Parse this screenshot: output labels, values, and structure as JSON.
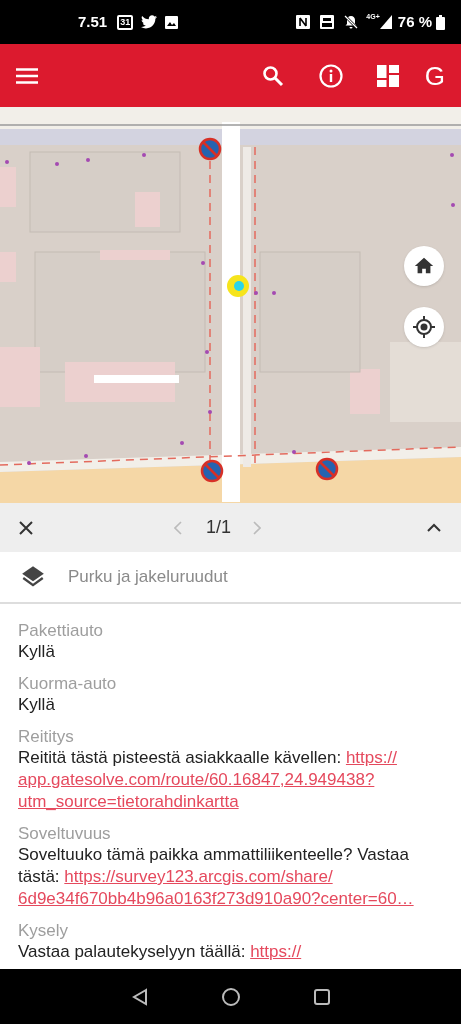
{
  "status_bar": {
    "time": "7.51",
    "calendar_day": "31",
    "network": "4G+",
    "battery": "76 %"
  },
  "app_bar": {
    "profile_letter": "G"
  },
  "popup": {
    "pager": "1/1",
    "layer": {
      "title": "Purku ja jakeluruudut"
    },
    "fields": [
      {
        "label": "Pakettiauto",
        "text": "Kyllä"
      },
      {
        "label": "Kuorma-auto",
        "text": "Kyllä"
      },
      {
        "label": "Reititys",
        "text": "Reititä tästä pisteestä asiakkaalle kävellen: ",
        "link_lines": [
          "https://",
          "app.gatesolve.com/route/60.16847,24.949438?",
          "utm_source=tietorahdinkartta"
        ]
      },
      {
        "label": "Soveltuvuus",
        "text": "Soveltuuko tämä paikka ammattiliikenteelle? Vastaa tästä: ",
        "link_lines": [
          "https://survey123.arcgis.com/share/",
          "6d9e34f670bb4b96a0163f273d910a90?center=60…"
        ]
      },
      {
        "label": "Kysely",
        "text": "Vastaa palautekyselyyn täällä: ",
        "link_lines": [
          "https://"
        ]
      }
    ]
  }
}
